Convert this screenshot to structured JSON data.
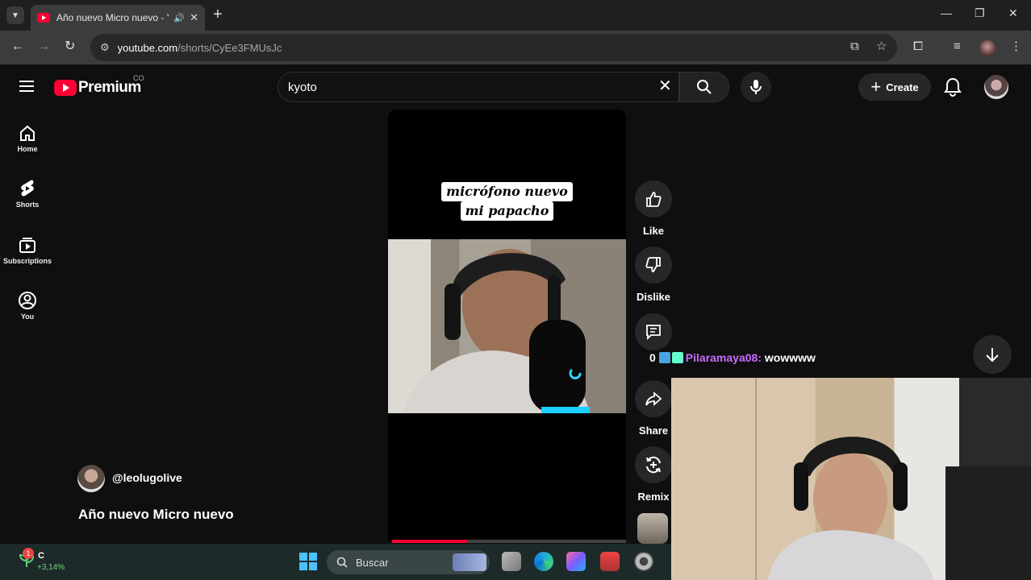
{
  "browser": {
    "tab_title": "Año nuevo Micro nuevo - Y",
    "url_host": "youtube.com",
    "url_path": "/shorts/CyEe3FMUsJc"
  },
  "header": {
    "logo_text": "Premium",
    "country_code": "CO",
    "search_value": "kyoto",
    "create_label": "Create"
  },
  "guide": {
    "items": [
      {
        "label": "Home",
        "icon": "home-icon"
      },
      {
        "label": "Shorts",
        "icon": "shorts-icon"
      },
      {
        "label": "Subscriptions",
        "icon": "subscriptions-icon"
      },
      {
        "label": "You",
        "icon": "you-icon"
      }
    ]
  },
  "short": {
    "caption_line1": "micrófono nuevo",
    "caption_line2": "mi papacho",
    "channel": "@leolugolive",
    "title": "Año nuevo Micro nuevo",
    "progress": 0.32
  },
  "actions": {
    "like": "Like",
    "dislike": "Dislike",
    "comments_count": "0",
    "share": "Share",
    "remix": "Remix"
  },
  "chat": {
    "user": "Pilaramaya08:",
    "message": "wowwww"
  },
  "taskbar": {
    "widget_badge": "1",
    "widget_name": "C",
    "widget_change": "+3,14%",
    "search_placeholder": "Buscar"
  },
  "colors": {
    "youtube_red": "#ff0033",
    "chat_user": "#c86bff",
    "stock_up": "#6cde7a"
  }
}
